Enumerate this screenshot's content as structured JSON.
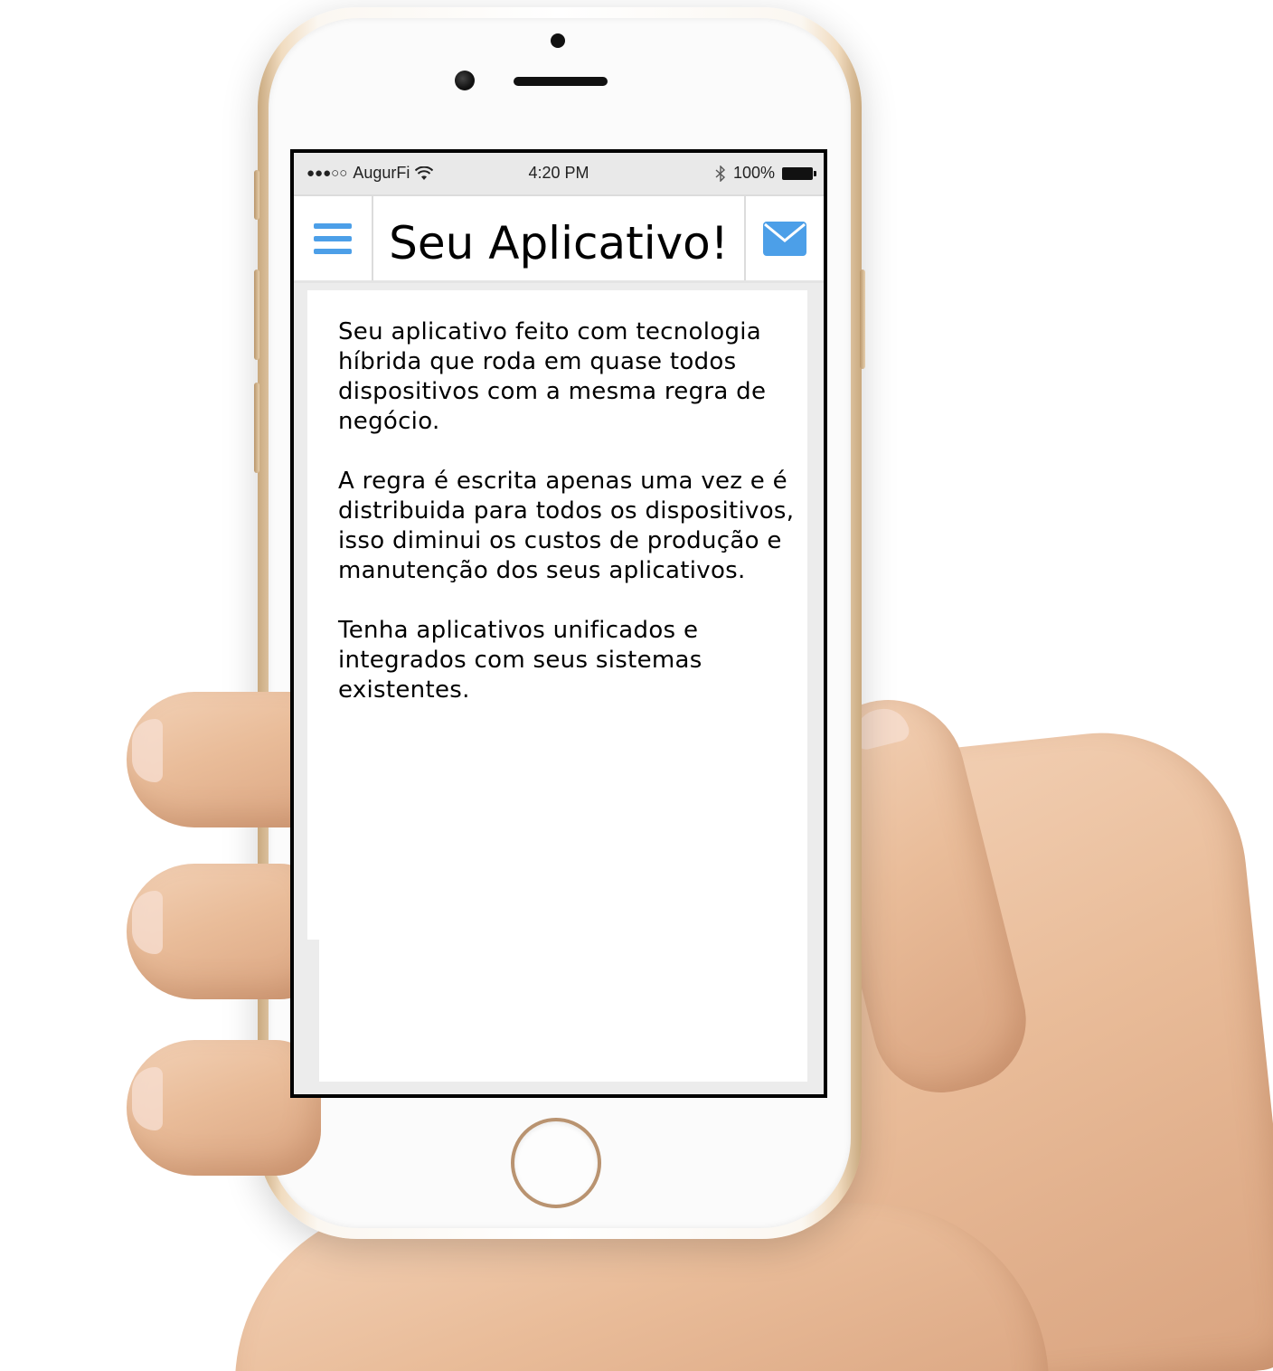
{
  "status_bar": {
    "signal": "●●●○○",
    "carrier": "AugurFi",
    "time": "4:20 PM",
    "battery": "100%"
  },
  "header": {
    "title": "Seu Aplicativo!",
    "menu_icon": "hamburger-menu-icon",
    "mail_icon": "envelope-icon"
  },
  "content": {
    "paragraphs": [
      "Seu aplicativo feito com tecnologia híbrida que roda em quase todos dispositivos com a mesma regra de negócio.",
      "A regra é escrita apenas uma vez e é distribuida para todos os dispositivos, isso diminui os custos de produção e manutenção dos seus aplicativos.",
      "Tenha aplicativos unificados e integrados com seus sistemas existentes."
    ]
  },
  "colors": {
    "accent": "#4c9fe8",
    "header_bg": "#ffffff",
    "content_bg": "#ececec",
    "status_bar_bg": "#e9e9e9"
  }
}
